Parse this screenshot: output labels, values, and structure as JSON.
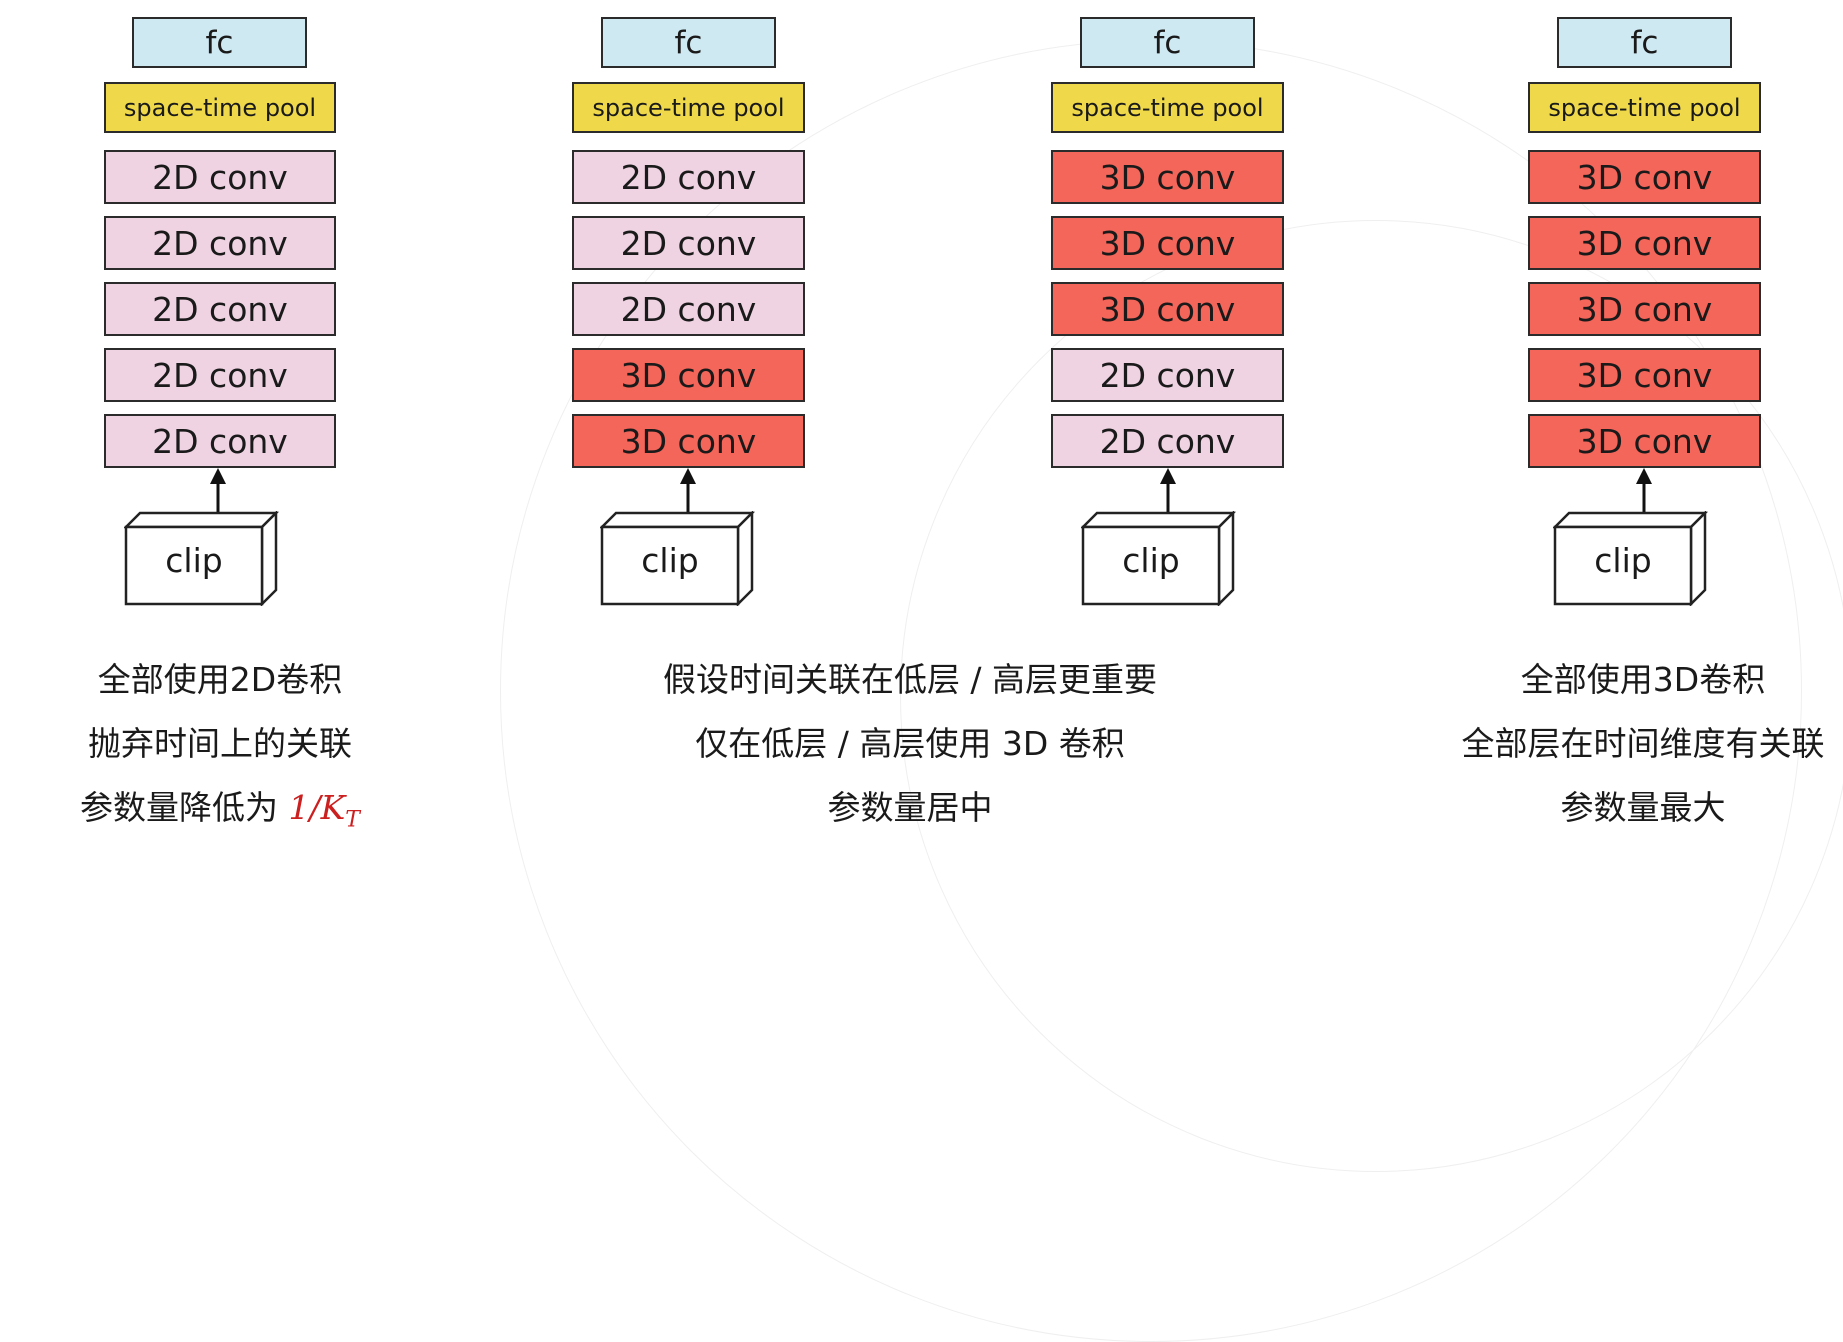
{
  "columns": [
    {
      "fc": "fc",
      "pool": "space-time pool",
      "layers": [
        {
          "label": "2D conv",
          "kind": "2d"
        },
        {
          "label": "2D conv",
          "kind": "2d"
        },
        {
          "label": "2D conv",
          "kind": "2d"
        },
        {
          "label": "2D conv",
          "kind": "2d"
        },
        {
          "label": "2D conv",
          "kind": "2d"
        }
      ],
      "input": "clip",
      "captions": [
        "全部使用2D卷积",
        "抛弃时间上的关联",
        "参数量降低为 "
      ],
      "formula": {
        "text": "1/K",
        "sub": "T"
      }
    },
    {
      "fc": "fc",
      "pool": "space-time pool",
      "layers": [
        {
          "label": "2D conv",
          "kind": "2d"
        },
        {
          "label": "2D conv",
          "kind": "2d"
        },
        {
          "label": "2D conv",
          "kind": "2d"
        },
        {
          "label": "3D conv",
          "kind": "3d"
        },
        {
          "label": "3D conv",
          "kind": "3d"
        }
      ],
      "input": "clip"
    },
    {
      "fc": "fc",
      "pool": "space-time pool",
      "layers": [
        {
          "label": "3D conv",
          "kind": "3d"
        },
        {
          "label": "3D conv",
          "kind": "3d"
        },
        {
          "label": "3D conv",
          "kind": "3d"
        },
        {
          "label": "2D conv",
          "kind": "2d"
        },
        {
          "label": "2D conv",
          "kind": "2d"
        }
      ],
      "input": "clip"
    },
    {
      "fc": "fc",
      "pool": "space-time pool",
      "layers": [
        {
          "label": "3D conv",
          "kind": "3d"
        },
        {
          "label": "3D conv",
          "kind": "3d"
        },
        {
          "label": "3D conv",
          "kind": "3d"
        },
        {
          "label": "3D conv",
          "kind": "3d"
        },
        {
          "label": "3D conv",
          "kind": "3d"
        }
      ],
      "input": "clip",
      "captions": [
        "全部使用3D卷积",
        "全部层在时间维度有关联",
        "参数量最大"
      ]
    }
  ],
  "middle_captions": [
    "假设时间关联在低层 / 高层更重要",
    "仅在低层 / 高层使用 3D 卷积",
    "参数量居中"
  ],
  "colors": {
    "fc": "#cfe9f3",
    "pool": "#efd94a",
    "conv2d": "#efd3e2",
    "conv3d": "#f4655a",
    "formula": "#cc1f1f"
  }
}
